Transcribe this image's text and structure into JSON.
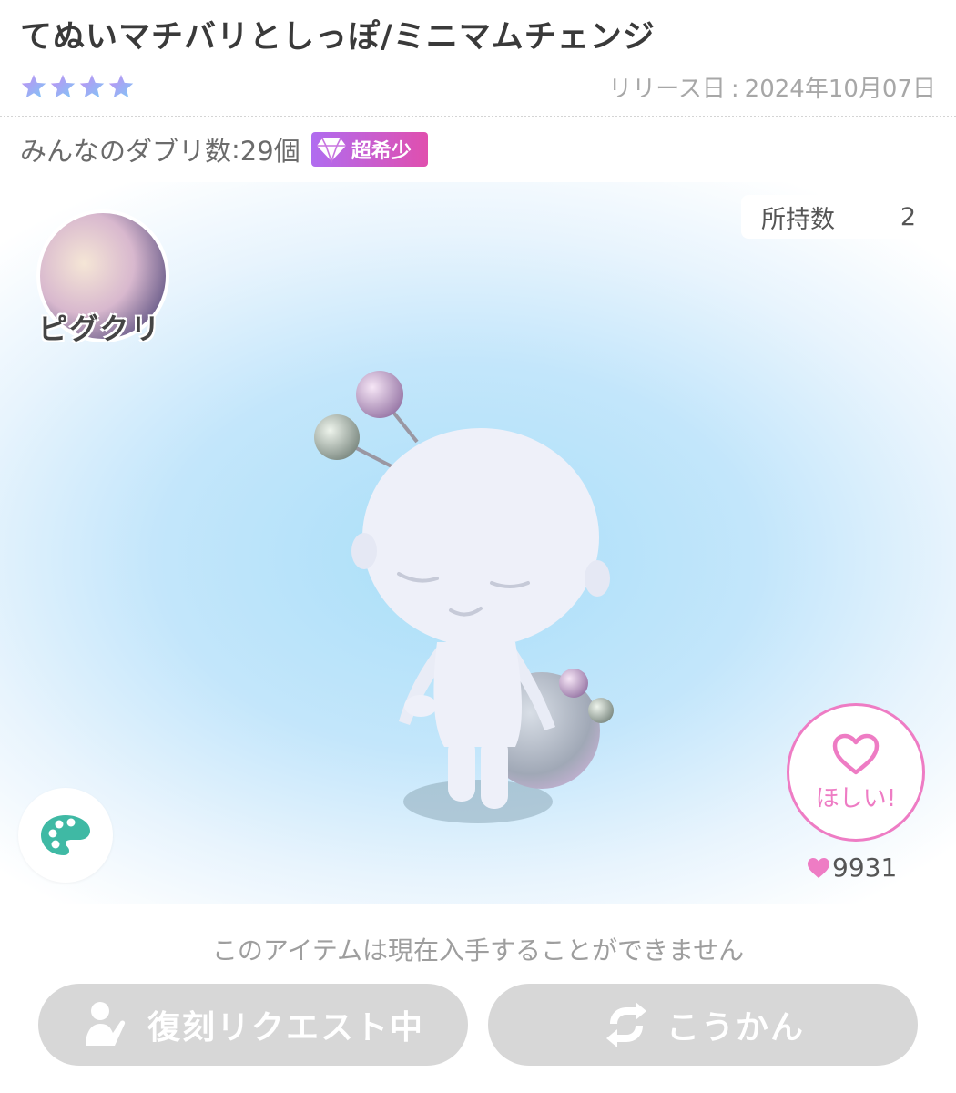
{
  "item": {
    "title": "てぬいマチバリとしっぽ/ミニマムチェンジ",
    "star_count": 4,
    "release_label": "リリース日",
    "release_date": "2024年10月07日",
    "dupes_label": "みんなのダブリ数",
    "dupes_value": "29個",
    "rarity": "超希少"
  },
  "stage": {
    "owned_label": "所持数",
    "owned_value": "2",
    "creator_name": "ピグクリ",
    "want_label": "ほしい!",
    "likes_count": "9931"
  },
  "footer": {
    "notice": "このアイテムは現在入手することができません",
    "reprint_label": "復刻リクエスト中",
    "trade_label": "こうかん"
  },
  "colors": {
    "accent_pink": "#ee7cc4",
    "rarity_gradient_start": "#b06cf0",
    "rarity_gradient_end": "#e04fae",
    "palette_teal": "#3fb9a4",
    "button_disabled": "#d7d7d7"
  },
  "icons": [
    "star-icon",
    "diamond-icon",
    "palette-icon",
    "heart-outline-icon",
    "heart-icon",
    "user-request-icon",
    "exchange-icon"
  ]
}
